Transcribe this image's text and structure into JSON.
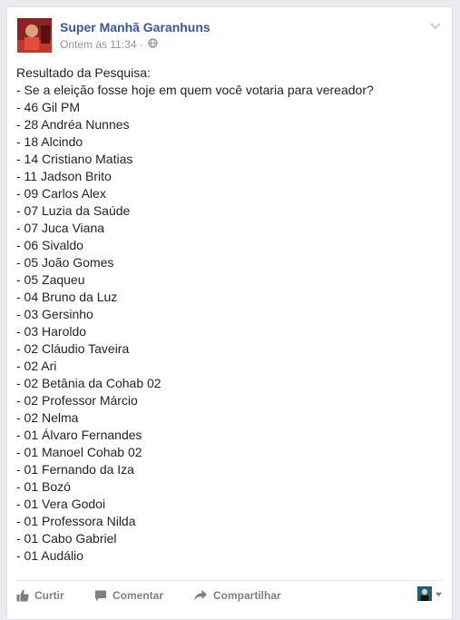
{
  "post": {
    "page_name": "Super Manhã Garanhuns",
    "timestamp": "Ontem às 11:34",
    "separator": "·",
    "lines": [
      "Resultado da Pesquisa:",
      "- Se a eleição fosse hoje em quem você votaria para vereador?",
      "- 46 Gil PM",
      "- 28 Andréa Nunnes",
      "- 18 Alcindo",
      "- 14 Cristiano Matias",
      "- 11 Jadson Brito",
      "- 09 Carlos Alex",
      "- 07 Luzia da Saúde",
      "- 07 Juca Viana",
      "- 06 Sivaldo",
      "- 05 João Gomes",
      "- 05 Zaqueu",
      "- 04 Bruno da Luz",
      "- 03 Gersinho",
      "- 03 Haroldo",
      "- 02 Cláudio Taveira",
      "- 02 Ari",
      "- 02 Betânia da Cohab 02",
      "- 02 Professor Márcio",
      "- 02 Nelma",
      "- 01 Álvaro Fernandes",
      "- 01 Manoel Cohab 02",
      "- 01 Fernando da Iza",
      "- 01 Bozó",
      "- 01 Vera Godoi",
      "- 01 Professora Nilda",
      "- 01 Cabo Gabriel",
      "- 01 Audálio"
    ]
  },
  "actions": {
    "like_label": "Curtir",
    "comment_label": "Comentar",
    "share_label": "Compartilhar"
  },
  "icons": {
    "audience": "globe-icon",
    "menu": "chevron-down-icon",
    "like": "thumbs-up-icon",
    "comment": "speech-bubble-icon",
    "share": "share-arrow-icon"
  },
  "colors": {
    "page_name": "#365899",
    "meta_text": "#90949c",
    "body_text": "#1d2129",
    "action_text": "#7f7f7f"
  }
}
